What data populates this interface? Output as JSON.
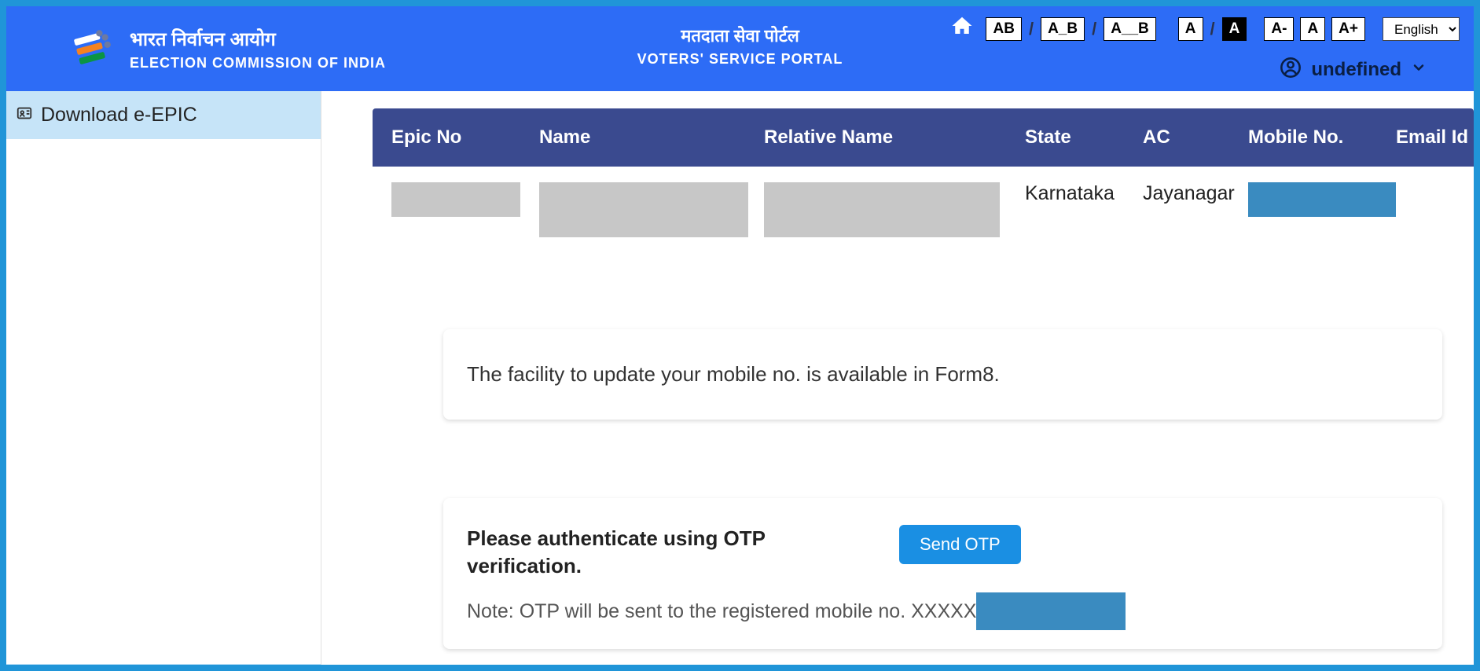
{
  "header": {
    "org_hindi": "भारत निर्वाचन आयोग",
    "org_english": "ELECTION COMMISSION OF INDIA",
    "portal_hindi": "मतदाता सेवा पोर्टल",
    "portal_english": "VOTERS' SERVICE PORTAL",
    "user_name": "undefined",
    "lang_value": "English",
    "controls": {
      "spacing1": "AB",
      "spacing2": "A_B",
      "spacing3": "A__B",
      "contrast1": "A",
      "contrast2": "A",
      "font_dec": "A-",
      "font_norm": "A",
      "font_inc": "A+"
    }
  },
  "sidebar": {
    "items": [
      {
        "label": "Download e-EPIC"
      }
    ]
  },
  "table": {
    "headers": {
      "epic": "Epic No",
      "name": "Name",
      "rel": "Relative Name",
      "state": "State",
      "ac": "AC",
      "mob": "Mobile No.",
      "email": "Email Id"
    },
    "row": {
      "state": "Karnataka",
      "ac": "Jayanagar"
    }
  },
  "info_card": {
    "text": "The facility to update your mobile no. is available in Form8."
  },
  "otp": {
    "title": "Please authenticate using OTP verification.",
    "button": "Send OTP",
    "note_prefix": "Note: OTP will be sent to the registered mobile no. XXXXX"
  }
}
